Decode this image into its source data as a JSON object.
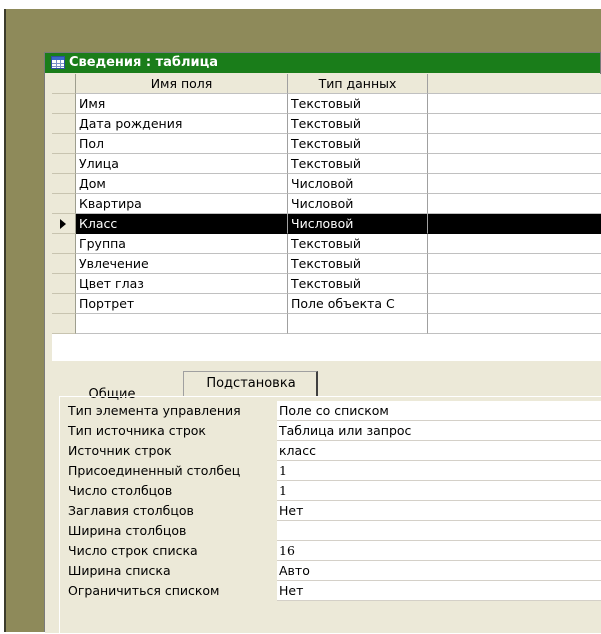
{
  "window": {
    "title": "Сведения : таблица",
    "title_bar_color": "#1a7d1a"
  },
  "grid": {
    "header": {
      "field_name": "Имя поля",
      "data_type": "Тип данных",
      "description": ""
    },
    "rows": [
      {
        "field_name": "Имя",
        "data_type": "Текстовый"
      },
      {
        "field_name": "Дата рождения",
        "data_type": "Текстовый"
      },
      {
        "field_name": "Пол",
        "data_type": "Текстовый"
      },
      {
        "field_name": "Улица",
        "data_type": "Текстовый"
      },
      {
        "field_name": "Дом",
        "data_type": "Числовой"
      },
      {
        "field_name": "Квартира",
        "data_type": "Числовой"
      },
      {
        "field_name": "Класс",
        "data_type": "Числовой",
        "selected": true
      },
      {
        "field_name": "Группа",
        "data_type": "Текстовый"
      },
      {
        "field_name": "Увлечение",
        "data_type": "Текстовый"
      },
      {
        "field_name": "Цвет глаз",
        "data_type": "Текстовый"
      },
      {
        "field_name": "Портрет",
        "data_type": "Поле объекта С"
      },
      {
        "field_name": "",
        "data_type": ""
      }
    ]
  },
  "tabs": {
    "general": "Общие",
    "lookup": "Подстановка",
    "active": "lookup"
  },
  "properties": [
    {
      "label": "Тип элемента управления",
      "value": "Поле со списком"
    },
    {
      "label": "Тип источника строк",
      "value": "Таблица или запрос"
    },
    {
      "label": "Источник строк",
      "value": "класс"
    },
    {
      "label": "Присоединенный столбец",
      "value": "1"
    },
    {
      "label": "Число столбцов",
      "value": "1"
    },
    {
      "label": "Заглавия столбцов",
      "value": "Нет"
    },
    {
      "label": "Ширина столбцов",
      "value": ""
    },
    {
      "label": "Число строк списка",
      "value": "16"
    },
    {
      "label": "Ширина списка",
      "value": "Авто"
    },
    {
      "label": "Ограничиться списком",
      "value": "Нет"
    }
  ]
}
